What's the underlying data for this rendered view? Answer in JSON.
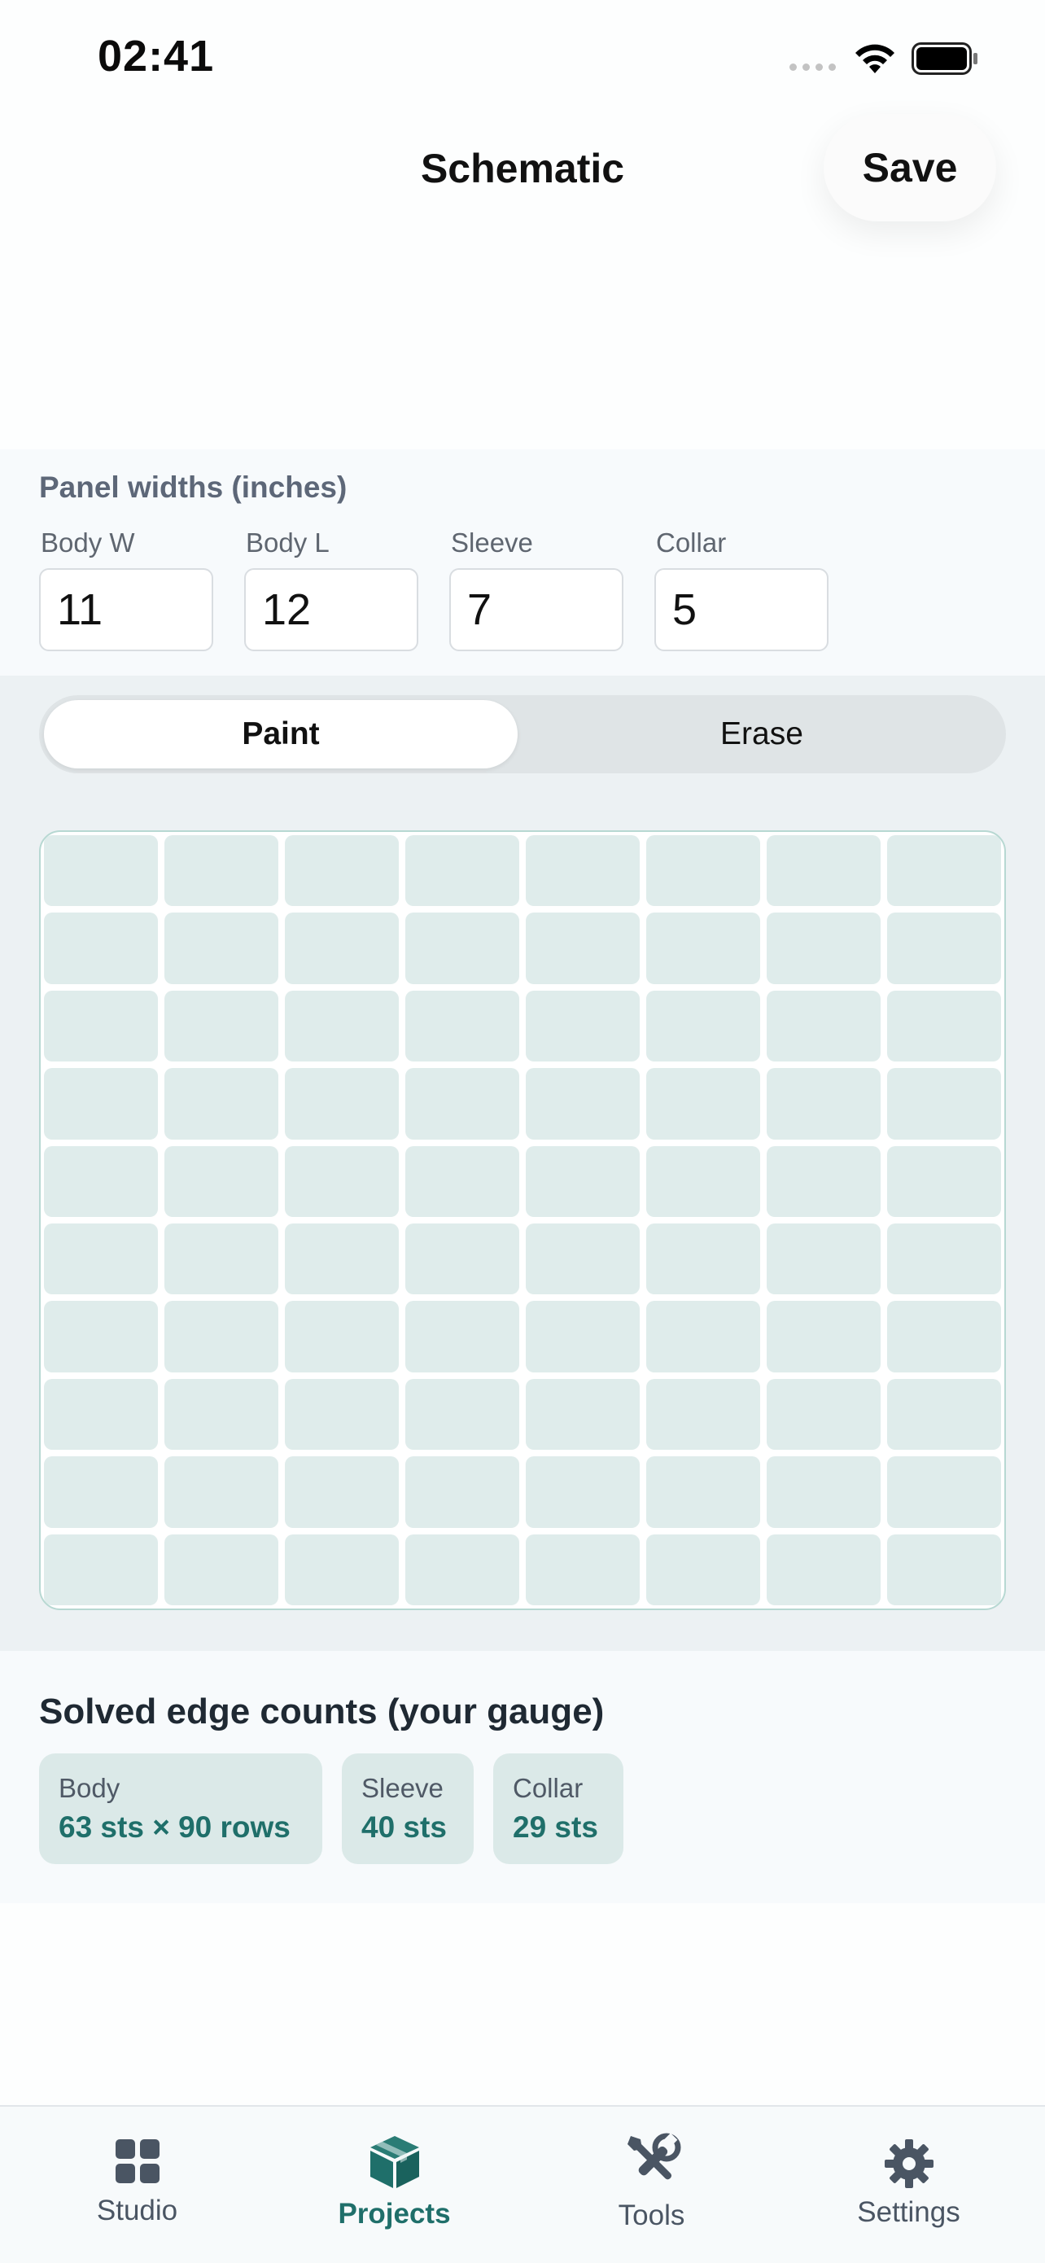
{
  "status": {
    "time": "02:41"
  },
  "header": {
    "title": "Schematic",
    "save_label": "Save"
  },
  "panel": {
    "title": "Panel widths (inches)",
    "fields": [
      {
        "label": "Body W",
        "value": "11"
      },
      {
        "label": "Body L",
        "value": "12"
      },
      {
        "label": "Sleeve",
        "value": "7"
      },
      {
        "label": "Collar",
        "value": "5"
      }
    ]
  },
  "mode": {
    "paint_label": "Paint",
    "erase_label": "Erase",
    "selected": "Paint"
  },
  "grid": {
    "columns": 8,
    "rows": 10
  },
  "solved": {
    "title": "Solved edge counts (your gauge)",
    "chips": [
      {
        "label": "Body",
        "value": "63 sts × 90 rows"
      },
      {
        "label": "Sleeve",
        "value": "40 sts"
      },
      {
        "label": "Collar",
        "value": "29 sts"
      }
    ]
  },
  "tabs": [
    {
      "label": "Studio",
      "icon": "grid-icon"
    },
    {
      "label": "Projects",
      "icon": "box-icon",
      "active": true
    },
    {
      "label": "Tools",
      "icon": "tools-icon"
    },
    {
      "label": "Settings",
      "icon": "gear-icon"
    }
  ],
  "colors": {
    "accent": "#1f6f6a",
    "tab_inactive": "#4a5563",
    "cell": "#dfeceb"
  }
}
